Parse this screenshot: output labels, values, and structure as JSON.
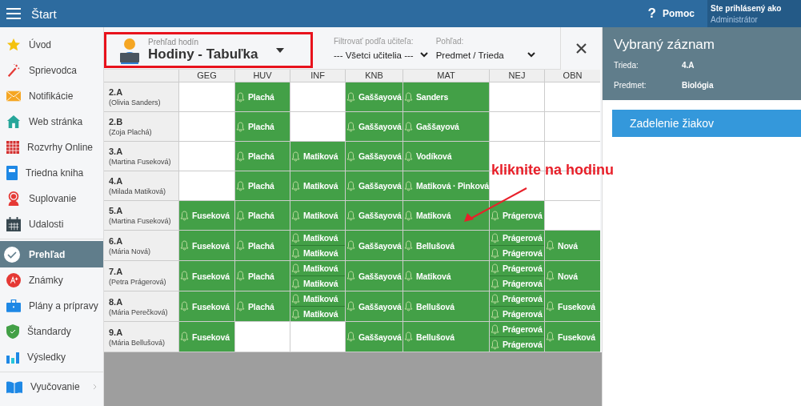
{
  "topbar": {
    "title": "Štart",
    "help_icon": "?",
    "help": "Pomoc",
    "user_label": "Ste prihlásený ako",
    "user_role": "Administrátor"
  },
  "sidebar": {
    "sections": [
      {
        "items": [
          {
            "label": "Úvod",
            "selected": false,
            "submenu": false
          },
          {
            "label": "Sprievodca",
            "selected": false,
            "submenu": false
          },
          {
            "label": "Notifikácie",
            "selected": false,
            "submenu": false
          },
          {
            "label": "Web stránka",
            "selected": false,
            "submenu": false
          },
          {
            "label": "Rozvrhy Online",
            "selected": false,
            "submenu": false
          },
          {
            "label": "Triedna kniha",
            "selected": false,
            "submenu": false
          },
          {
            "label": "Suplovanie",
            "selected": false,
            "submenu": false
          },
          {
            "label": "Udalosti",
            "selected": false,
            "submenu": false
          }
        ]
      },
      {
        "items": [
          {
            "label": "Prehľad",
            "selected": true,
            "submenu": false
          },
          {
            "label": "Známky",
            "selected": false,
            "submenu": false
          },
          {
            "label": "Plány a prípravy",
            "selected": false,
            "submenu": false
          },
          {
            "label": "Štandardy",
            "selected": false,
            "submenu": false
          },
          {
            "label": "Výsledky",
            "selected": false,
            "submenu": false
          }
        ]
      },
      {
        "items": [
          {
            "label": "Vyučovanie",
            "selected": false,
            "submenu": true
          }
        ]
      }
    ]
  },
  "toolbar": {
    "view_caption": "Prehľad hodín",
    "view_title": "Hodiny - Tabuľka",
    "highlighted": true,
    "filter": {
      "label": "Filtrovať podľa učiteľa:",
      "value": "--- Všetci učitelia ---"
    },
    "mode": {
      "label": "Pohľad:",
      "value": "Predmet / Trieda"
    }
  },
  "table": {
    "columns": [
      "GEG",
      "HUV",
      "INF",
      "KNB",
      "MAT",
      "NEJ",
      "OBN"
    ],
    "rows": [
      {
        "class": "2.A",
        "teacher": "(Olivia Sanders)",
        "cells": [
          [],
          [
            "Plachá"
          ],
          [],
          [
            "Gaššayová"
          ],
          [
            "Sanders"
          ],
          [],
          []
        ]
      },
      {
        "class": "2.B",
        "teacher": "(Zoja Plachá)",
        "cells": [
          [],
          [
            "Plachá"
          ],
          [],
          [
            "Gaššayová"
          ],
          [
            "Gaššayová"
          ],
          [],
          []
        ]
      },
      {
        "class": "3.A",
        "teacher": "(Martina Fuseková)",
        "cells": [
          [],
          [
            "Plachá"
          ],
          [
            "Matiková"
          ],
          [
            "Gaššayová"
          ],
          [
            "Vodíková"
          ],
          [],
          []
        ]
      },
      {
        "class": "4.A",
        "teacher": "(Milada Matiková)",
        "cells": [
          [],
          [
            "Plachá"
          ],
          [
            "Matiková"
          ],
          [
            "Gaššayová"
          ],
          [
            "Matiková · Pinková"
          ],
          [],
          []
        ]
      },
      {
        "class": "5.A",
        "teacher": "(Martina Fuseková)",
        "cells": [
          [
            "Fuseková"
          ],
          [
            "Plachá"
          ],
          [
            "Matiková"
          ],
          [
            "Gaššayová"
          ],
          [
            "Matiková"
          ],
          [
            "Prágerová"
          ],
          []
        ]
      },
      {
        "class": "6.A",
        "teacher": "(Mária Nová)",
        "cells": [
          [
            "Fuseková"
          ],
          [
            "Plachá"
          ],
          [
            "Matiková",
            "Matiková"
          ],
          [
            "Gaššayová"
          ],
          [
            "Bellušová"
          ],
          [
            "Prágerová",
            "Prágerová"
          ],
          [
            "Nová"
          ]
        ]
      },
      {
        "class": "7.A",
        "teacher": "(Petra Prágerová)",
        "cells": [
          [
            "Fuseková"
          ],
          [
            "Plachá"
          ],
          [
            "Matiková",
            "Matiková"
          ],
          [
            "Gaššayová"
          ],
          [
            "Matiková"
          ],
          [
            "Prágerová",
            "Prágerová"
          ],
          [
            "Nová"
          ]
        ]
      },
      {
        "class": "8.A",
        "teacher": "(Mária Perečková)",
        "cells": [
          [
            "Fuseková"
          ],
          [
            "Plachá"
          ],
          [
            "Matiková",
            "Matiková"
          ],
          [
            "Gaššayová"
          ],
          [
            "Bellušová"
          ],
          [
            "Prágerová",
            "Prágerová"
          ],
          [
            "Fuseková"
          ]
        ]
      },
      {
        "class": "9.A",
        "teacher": "(Mária Bellušová)",
        "cells": [
          [
            "Fuseková"
          ],
          [],
          [],
          [
            "Gaššayová"
          ],
          [
            "Bellušová"
          ],
          [
            "Prágerová",
            "Prágerová"
          ],
          [
            "Fuseková"
          ]
        ]
      }
    ]
  },
  "annotation": {
    "text": "kliknite na hodinu"
  },
  "detail": {
    "title": "Vybraný záznam",
    "fields": [
      {
        "label": "Trieda:",
        "value": "4.A"
      },
      {
        "label": "Predmet:",
        "value": "Biológia"
      }
    ],
    "button": "Zadelenie žiakov"
  }
}
